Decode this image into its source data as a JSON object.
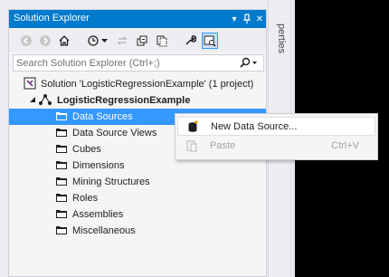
{
  "window": {
    "title": "Solution Explorer",
    "pin_glyph": "▾",
    "pin2_glyph": "⮌",
    "close_glyph": "✕"
  },
  "toolbar": {
    "buttons": [
      "back-icon",
      "forward-icon",
      "home-icon",
      "history-icon",
      "sync-icon",
      "collapse-all-icon",
      "show-all-files-icon",
      "properties-icon",
      "preview-icon"
    ]
  },
  "search": {
    "placeholder": "Search Solution Explorer (Ctrl+;)",
    "icon": "search-icon"
  },
  "tree": {
    "solution": "Solution 'LogisticRegressionExample' (1 project)",
    "project": "LogisticRegressionExample",
    "folders": [
      "Data Sources",
      "Data Source Views",
      "Cubes",
      "Dimensions",
      "Mining Structures",
      "Roles",
      "Assemblies",
      "Miscellaneous"
    ],
    "selected_index": 0
  },
  "side_tab": {
    "label": "perties"
  },
  "context_menu": {
    "items": [
      {
        "label": "New Data Source...",
        "shortcut": "",
        "enabled": true,
        "icon": "new-data-source-icon"
      },
      {
        "label": "Paste",
        "shortcut": "Ctrl+V",
        "enabled": false,
        "icon": "paste-icon"
      }
    ]
  },
  "colors": {
    "accent": "#007acc",
    "selection": "#3399ff",
    "folder": "#1e1e1e"
  }
}
